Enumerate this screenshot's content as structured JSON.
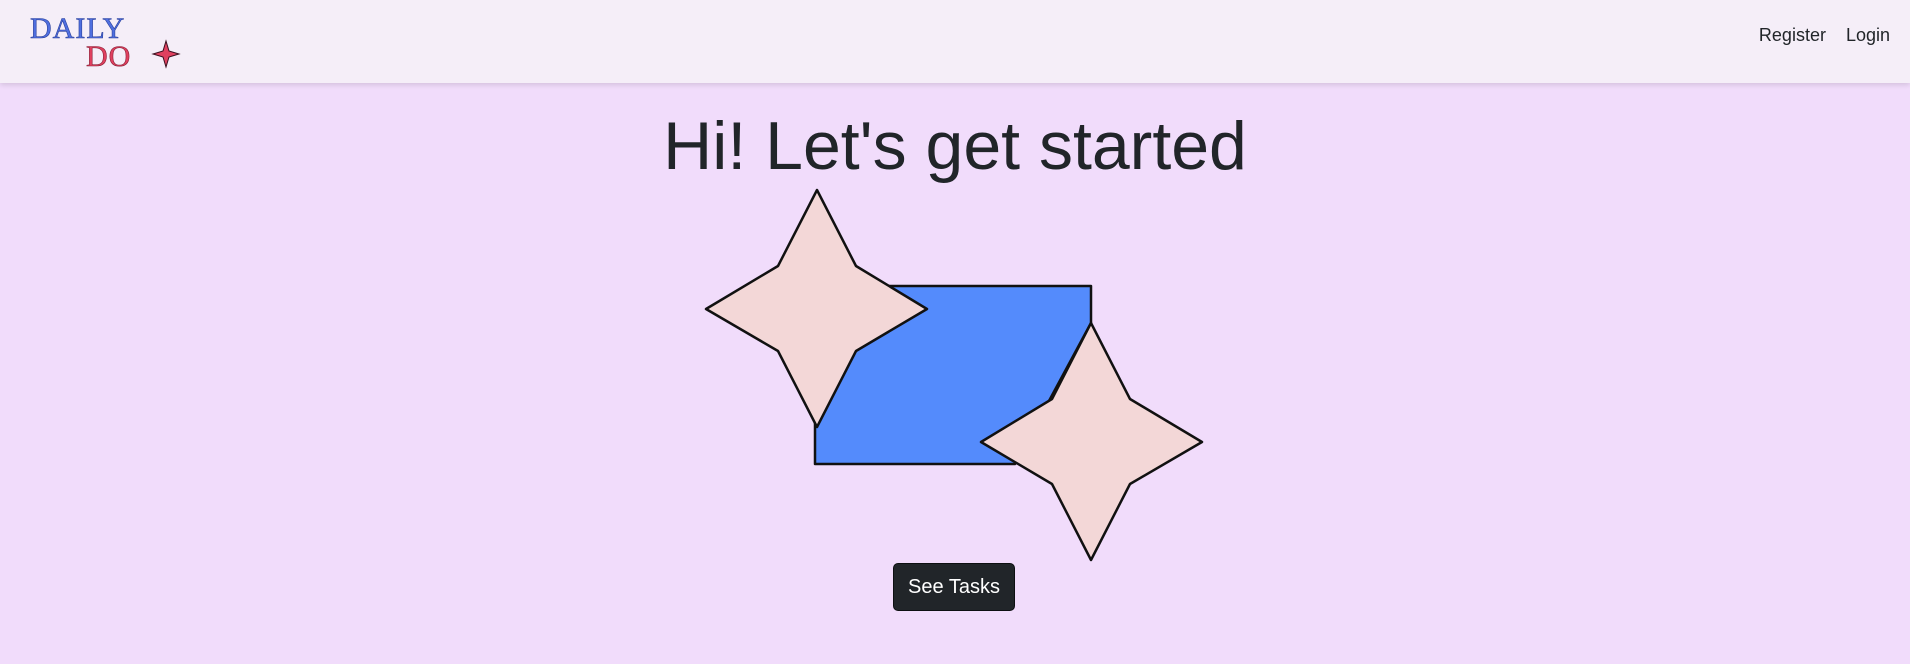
{
  "brand": {
    "line1": "DAILY",
    "line2": "DO",
    "colors": {
      "line1": "#4f6fe0",
      "line2": "#e0405f",
      "sparkle": "#e0405f"
    }
  },
  "nav": {
    "items": [
      {
        "label": "Register"
      },
      {
        "label": "Login"
      }
    ]
  },
  "hero": {
    "title": "Hi! Let's get started",
    "cta_label": "See Tasks"
  },
  "colors": {
    "page_background": "#f1dcfb",
    "navbar_background": "#f5eef8",
    "parallelogram_fill": "#548bfc",
    "star_fill": "#f3d7d7",
    "button_background": "#212529"
  }
}
